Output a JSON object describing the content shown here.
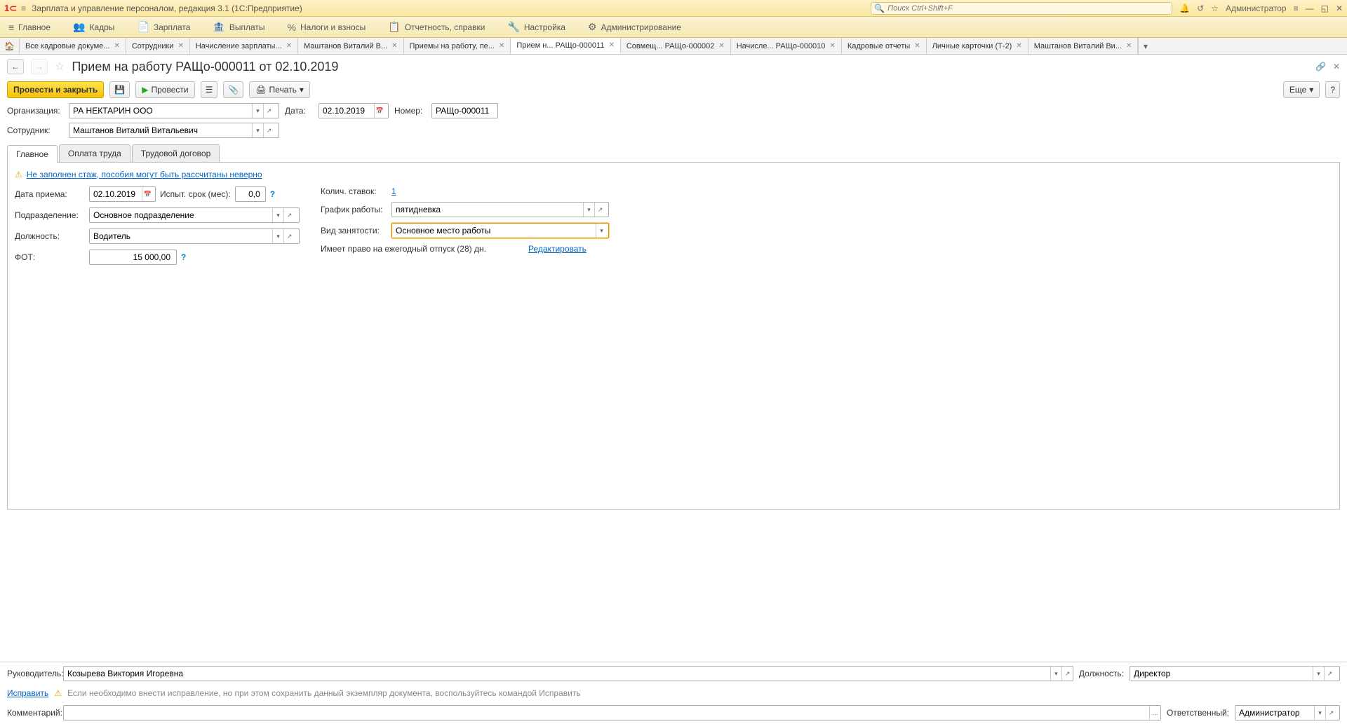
{
  "titlebar": {
    "app_title": "Зарплата и управление персоналом, редакция 3.1  (1С:Предприятие)",
    "search_placeholder": "Поиск Ctrl+Shift+F",
    "user": "Администратор"
  },
  "menubar": [
    {
      "icon": "≡",
      "label": "Главное"
    },
    {
      "icon": "👥",
      "label": "Кадры"
    },
    {
      "icon": "📄",
      "label": "Зарплата"
    },
    {
      "icon": "💰",
      "label": "Выплаты"
    },
    {
      "icon": "%",
      "label": "Налоги и взносы"
    },
    {
      "icon": "📋",
      "label": "Отчетность, справки"
    },
    {
      "icon": "🔧",
      "label": "Настройка"
    },
    {
      "icon": "⚙",
      "label": "Администрирование"
    }
  ],
  "tabs": [
    {
      "label": "Все кадровые докуме...",
      "active": false
    },
    {
      "label": "Сотрудники",
      "active": false
    },
    {
      "label": "Начисление зарплаты...",
      "active": false
    },
    {
      "label": "Маштанов Виталий В...",
      "active": false
    },
    {
      "label": "Приемы на работу, пе...",
      "active": false
    },
    {
      "label": "Прием н... РАЩо-000011",
      "active": true
    },
    {
      "label": "Совмещ... РАЩо-000002",
      "active": false
    },
    {
      "label": "Начисле... РАЩо-000010",
      "active": false
    },
    {
      "label": "Кадровые отчеты",
      "active": false
    },
    {
      "label": "Личные карточки (Т-2)",
      "active": false
    },
    {
      "label": "Маштанов Виталий Ви...",
      "active": false
    }
  ],
  "page": {
    "title": "Прием на работу РАЩо-000011 от 02.10.2019"
  },
  "toolbar": {
    "post_close": "Провести и закрыть",
    "post": "Провести",
    "print": "Печать",
    "more": "Еще"
  },
  "header_fields": {
    "org_label": "Организация:",
    "org_value": "РА НЕКТАРИН ООО",
    "date_label": "Дата:",
    "date_value": "02.10.2019",
    "number_label": "Номер:",
    "number_value": "РАЩо-000011",
    "employee_label": "Сотрудник:",
    "employee_value": "Маштанов Виталий Витальевич"
  },
  "doc_tabs": [
    "Главное",
    "Оплата труда",
    "Трудовой договор"
  ],
  "warning": "Не заполнен стаж, пособия могут быть рассчитаны неверно",
  "main": {
    "hire_date_label": "Дата приема:",
    "hire_date": "02.10.2019",
    "probation_label": "Испыт. срок (мес):",
    "probation": "0,0",
    "division_label": "Подразделение:",
    "division": "Основное подразделение",
    "position_label": "Должность:",
    "position": "Водитель",
    "fot_label": "ФОТ:",
    "fot": "15 000,00",
    "rates_label": "Колич. ставок:",
    "rates": "1",
    "schedule_label": "График работы:",
    "schedule": "пятидневка",
    "employment_type_label": "Вид занятости:",
    "employment_type": "Основное место работы",
    "vacation_text": "Имеет право на ежегодный отпуск (28) дн.",
    "edit_link": "Редактировать"
  },
  "footer": {
    "manager_label": "Руководитель:",
    "manager": "Козырева Виктория Игоревна",
    "position_label": "Должность:",
    "position": "Директор",
    "fix_link": "Исправить",
    "fix_text": "Если необходимо внести исправление, но при этом сохранить данный экземпляр документа, воспользуйтесь командой Исправить",
    "comment_label": "Комментарий:",
    "comment": "",
    "responsible_label": "Ответственный:",
    "responsible": "Администратор"
  }
}
